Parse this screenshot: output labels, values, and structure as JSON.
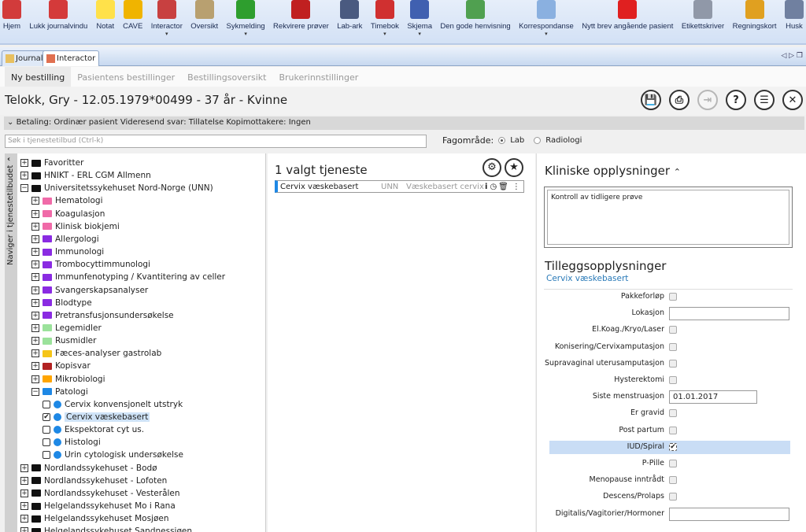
{
  "toolbar": [
    {
      "label": "Hjem",
      "icon": "home-icon",
      "color": "#d23b3b"
    },
    {
      "label": "Lukk journalvindu",
      "icon": "close-journal-icon",
      "color": "#d43a3a"
    },
    {
      "label": "Notat",
      "icon": "note-icon",
      "color": "#ffe14a"
    },
    {
      "label": "CAVE",
      "icon": "warning-icon",
      "color": "#f0b400"
    },
    {
      "label": "Interactor",
      "icon": "interactor-icon",
      "color": "#c84040",
      "dropdown": true
    },
    {
      "label": "Oversikt",
      "icon": "overview-icon",
      "color": "#b8a070"
    },
    {
      "label": "Sykmelding",
      "icon": "sick-leave-icon",
      "color": "#2e9e2e",
      "dropdown": true
    },
    {
      "label": "Rekvirere prøver",
      "icon": "test-tube-icon",
      "color": "#c02020"
    },
    {
      "label": "Lab-ark",
      "icon": "lab-sheet-icon",
      "color": "#4a5a80"
    },
    {
      "label": "Timebok",
      "icon": "calendar-icon",
      "color": "#d03030",
      "dropdown": true
    },
    {
      "label": "Skjema",
      "icon": "form-icon",
      "color": "#4060b0",
      "dropdown": true
    },
    {
      "label": "Den gode henvisning",
      "icon": "referral-icon",
      "color": "#50a050"
    },
    {
      "label": "Korrespondanse",
      "icon": "envelope-icon",
      "color": "#8ab0e0",
      "dropdown": true
    },
    {
      "label": "Nytt brev angående pasient",
      "icon": "new-letter-icon",
      "color": "#e02020"
    },
    {
      "label": "Etikettskriver",
      "icon": "printer-icon",
      "color": "#9098a8"
    },
    {
      "label": "Regningskort",
      "icon": "coins-icon",
      "color": "#e0a020"
    },
    {
      "label": "Husk",
      "icon": "reminder-icon",
      "color": "#7080a0"
    }
  ],
  "window_tabs": [
    "Journal",
    "Interactor"
  ],
  "subtabs": [
    "Ny bestilling",
    "Pasientens bestillinger",
    "Bestillingsoversikt",
    "Brukerinnstillinger"
  ],
  "patient": {
    "title": "Telokk, Gry - 12.05.1979*00499 - 37 år - Kvinne"
  },
  "header_buttons": [
    {
      "name": "save-button",
      "icon": "save-icon",
      "glyph": "💾"
    },
    {
      "name": "print-button",
      "icon": "printer-icon",
      "glyph": "⎙"
    },
    {
      "name": "send-button",
      "icon": "send-icon",
      "glyph": "⇥",
      "disabled": true
    },
    {
      "name": "help-button",
      "icon": "book-icon",
      "glyph": "?"
    },
    {
      "name": "list-favorites-button",
      "icon": "list-star-icon",
      "glyph": "☰"
    },
    {
      "name": "close-button",
      "icon": "close-icon",
      "glyph": "✕"
    }
  ],
  "betaling": "Betaling: Ordinær pasient Videresend svar: Tillatelse Kopimottakere: Ingen",
  "search": {
    "placeholder": "Søk i tjenestetilbud (Ctrl-k)",
    "value": ""
  },
  "fagomrade": {
    "label": "Fagområde:",
    "options": [
      "Lab",
      "Radiologi"
    ],
    "selected": "Lab"
  },
  "sidenav_label": "Naviger i tjenestetilbudet",
  "tree": [
    {
      "label": "Favoritter",
      "level": 0,
      "type": "folder",
      "color": "#111",
      "expanded": false
    },
    {
      "label": "HNIKT - ERL CGM Allmenn",
      "level": 0,
      "type": "folder",
      "color": "#111",
      "expanded": false
    },
    {
      "label": "Universitetssykehuset Nord-Norge (UNN)",
      "level": 0,
      "type": "folder",
      "color": "#111",
      "expanded": true
    },
    {
      "label": "Hematologi",
      "level": 1,
      "type": "folder",
      "color": "#f06aa8",
      "expanded": false
    },
    {
      "label": "Koagulasjon",
      "level": 1,
      "type": "folder",
      "color": "#f06aa8",
      "expanded": false
    },
    {
      "label": "Klinisk biokjemi",
      "level": 1,
      "type": "folder",
      "color": "#f06aa8",
      "expanded": false
    },
    {
      "label": "Allergologi",
      "level": 1,
      "type": "folder",
      "color": "#8a2be2",
      "expanded": false
    },
    {
      "label": "Immunologi",
      "level": 1,
      "type": "folder",
      "color": "#8a2be2",
      "expanded": false
    },
    {
      "label": "Trombocyttimmunologi",
      "level": 1,
      "type": "folder",
      "color": "#8a2be2",
      "expanded": false
    },
    {
      "label": "Immunfenotyping / Kvantitering av celler",
      "level": 1,
      "type": "folder",
      "color": "#8a2be2",
      "expanded": false
    },
    {
      "label": "Svangerskapsanalyser",
      "level": 1,
      "type": "folder",
      "color": "#8a2be2",
      "expanded": false
    },
    {
      "label": "Blodtype",
      "level": 1,
      "type": "folder",
      "color": "#8a2be2",
      "expanded": false
    },
    {
      "label": "Pretransfusjonsundersøkelse",
      "level": 1,
      "type": "folder",
      "color": "#8a2be2",
      "expanded": false
    },
    {
      "label": "Legemidler",
      "level": 1,
      "type": "folder",
      "color": "#9be29b",
      "expanded": false
    },
    {
      "label": "Rusmidler",
      "level": 1,
      "type": "folder",
      "color": "#9be29b",
      "expanded": false
    },
    {
      "label": "Fæces-analyser gastrolab",
      "level": 1,
      "type": "folder",
      "color": "#f5c518",
      "expanded": false
    },
    {
      "label": "Kopisvar",
      "level": 1,
      "type": "folder",
      "color": "#b22222",
      "expanded": false
    },
    {
      "label": "Mikrobiologi",
      "level": 1,
      "type": "folder",
      "color": "#ffa500",
      "expanded": false
    },
    {
      "label": "Patologi",
      "level": 1,
      "type": "folder",
      "color": "#1e88e5",
      "expanded": true
    },
    {
      "label": "Cervix konvensjonelt utstryk",
      "level": 2,
      "type": "item",
      "checked": false
    },
    {
      "label": "Cervix væskebasert",
      "level": 2,
      "type": "item",
      "checked": true
    },
    {
      "label": "Ekspektorat cyt us.",
      "level": 2,
      "type": "item",
      "checked": false
    },
    {
      "label": "Histologi",
      "level": 2,
      "type": "item",
      "checked": false
    },
    {
      "label": "Urin cytologisk undersøkelse",
      "level": 2,
      "type": "item",
      "checked": false
    },
    {
      "label": "Nordlandssykehuset - Bodø",
      "level": 0,
      "type": "folder",
      "color": "#111",
      "expanded": false
    },
    {
      "label": "Nordlandssykehuset - Lofoten",
      "level": 0,
      "type": "folder",
      "color": "#111",
      "expanded": false
    },
    {
      "label": "Nordlandssykehuset - Vesterålen",
      "level": 0,
      "type": "folder",
      "color": "#111",
      "expanded": false
    },
    {
      "label": "Helgelandssykehuset Mo i Rana",
      "level": 0,
      "type": "folder",
      "color": "#111",
      "expanded": false
    },
    {
      "label": "Helgelandssykehuset Mosjøen",
      "level": 0,
      "type": "folder",
      "color": "#111",
      "expanded": false
    },
    {
      "label": "Helgelandssykehuset Sandnessjøen",
      "level": 0,
      "type": "folder",
      "color": "#111",
      "expanded": false
    }
  ],
  "selected": {
    "title": "1 valgt tjeneste",
    "service": {
      "name": "Cervix væskebasert",
      "lab": "UNN",
      "description": "Væskebasert cervix"
    }
  },
  "kliniske": {
    "title": "Kliniske opplysninger",
    "text": "Kontroll av tidligere prøve"
  },
  "tillegg": {
    "title": "Tilleggsopplysninger",
    "subtitle": "Cervix væskebasert",
    "fields": [
      {
        "label": "Pakkeforløp",
        "type": "checkbox",
        "checked": false
      },
      {
        "label": "Lokasjon",
        "type": "text",
        "value": ""
      },
      {
        "label": "El.Koag./Kryo/Laser",
        "type": "checkbox",
        "checked": false
      },
      {
        "label": "Konisering/Cervixamputasjon",
        "type": "checkbox",
        "checked": false
      },
      {
        "label": "Supravaginal uterusamputasjon",
        "type": "checkbox",
        "checked": false
      },
      {
        "label": "Hysterektomi",
        "type": "checkbox",
        "checked": false
      },
      {
        "label": "Siste menstruasjon",
        "type": "date",
        "value": "01.01.2017"
      },
      {
        "label": "Er gravid",
        "type": "checkbox",
        "checked": false
      },
      {
        "label": "Post partum",
        "type": "checkbox",
        "checked": false
      },
      {
        "label": "IUD/Spiral",
        "type": "checkbox",
        "checked": true,
        "highlighted": true
      },
      {
        "label": "P-Pille",
        "type": "checkbox",
        "checked": false
      },
      {
        "label": "Menopause inntrådt",
        "type": "checkbox",
        "checked": false
      },
      {
        "label": "Descens/Prolaps",
        "type": "checkbox",
        "checked": false
      },
      {
        "label": "Digitalis/Vagitorier/Hormoner",
        "type": "text",
        "value": ""
      }
    ]
  }
}
